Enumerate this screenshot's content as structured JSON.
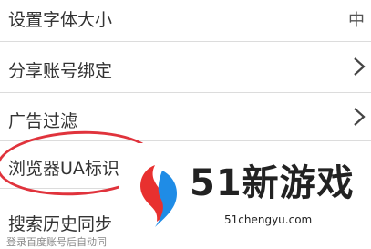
{
  "settings": {
    "items": [
      {
        "label": "设置字体大小",
        "value": "中"
      },
      {
        "label": "分享账号绑定"
      },
      {
        "label": "广告过滤"
      },
      {
        "label": "浏览器UA标识"
      },
      {
        "label": "搜索历史同步",
        "sublabel": "登录百度账号后自动同"
      }
    ]
  },
  "watermark": {
    "title": "51新游戏",
    "url": "51chengyu.com"
  },
  "colors": {
    "highlight_ring": "#e0333c",
    "logo_red": "#e8302f",
    "logo_blue": "#1f8ce6",
    "divider": "#dcdcdc"
  }
}
